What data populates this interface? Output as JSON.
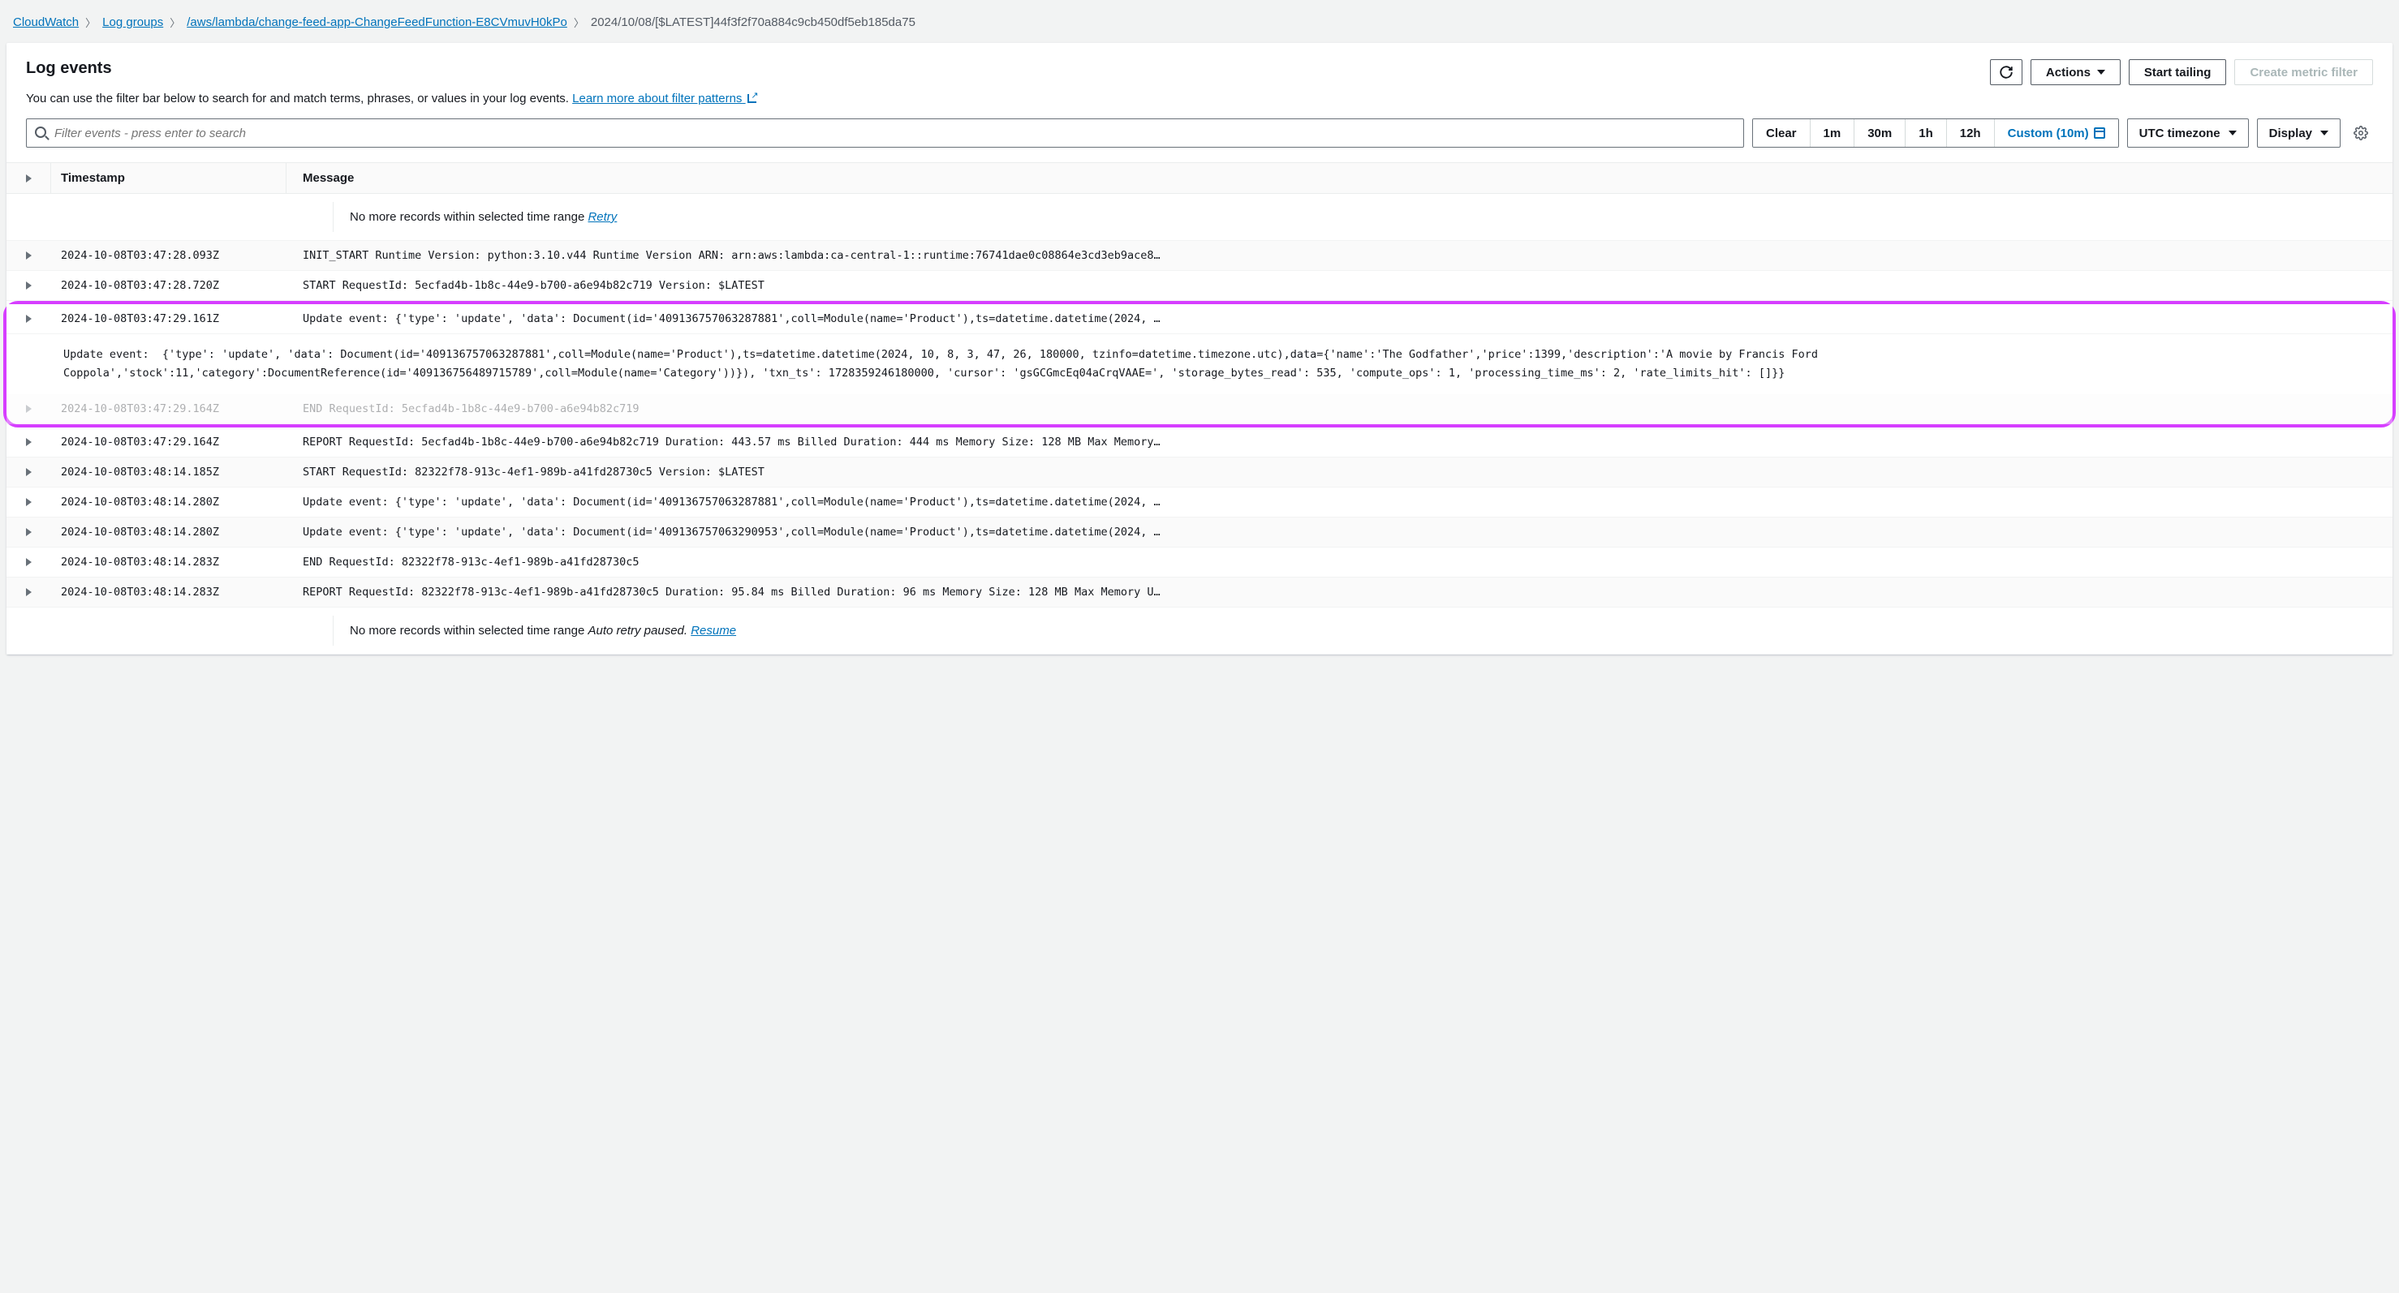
{
  "breadcrumb": {
    "items": [
      {
        "label": "CloudWatch",
        "link": true
      },
      {
        "label": "Log groups",
        "link": true
      },
      {
        "label": "/aws/lambda/change-feed-app-ChangeFeedFunction-E8CVmuvH0kPo",
        "link": true
      },
      {
        "label": "2024/10/08/[$LATEST]44f3f2f70a884c9cb450df5eb185da75",
        "link": false
      }
    ]
  },
  "header": {
    "title": "Log events",
    "subtext": "You can use the filter bar below to search for and match terms, phrases, or values in your log events. ",
    "learn_link": "Learn more about filter patterns",
    "actions_label": "Actions",
    "start_tailing_label": "Start tailing",
    "create_filter_label": "Create metric filter"
  },
  "controls": {
    "search_placeholder": "Filter events - press enter to search",
    "clear_label": "Clear",
    "ranges": [
      "1m",
      "30m",
      "1h",
      "12h"
    ],
    "custom_label": "Custom (10m)",
    "timezone_label": "UTC timezone",
    "display_label": "Display"
  },
  "table": {
    "col_timestamp": "Timestamp",
    "col_message": "Message",
    "top_info": "No more records within selected time range ",
    "retry_label": "Retry",
    "bottom_info_a": "No more records within selected time range ",
    "bottom_info_b": "Auto retry paused. ",
    "resume_label": "Resume"
  },
  "rows": [
    {
      "ts": "2024-10-08T03:47:28.093Z",
      "msg": "INIT_START Runtime Version: python:3.10.v44 Runtime Version ARN: arn:aws:lambda:ca-central-1::runtime:76741dae0c08864e3cd3eb9ace8…"
    },
    {
      "ts": "2024-10-08T03:47:28.720Z",
      "msg": "START RequestId: 5ecfad4b-1b8c-44e9-b700-a6e94b82c719 Version: $LATEST"
    },
    {
      "ts": "2024-10-08T03:47:29.161Z",
      "msg": "Update event: {'type': 'update', 'data': Document(id='409136757063287881',coll=Module(name='Product'),ts=datetime.datetime(2024, …",
      "expanded": true
    },
    {
      "ts": "2024-10-08T03:47:29.164Z",
      "msg": "END RequestId: 5ecfad4b-1b8c-44e9-b700-a6e94b82c719"
    },
    {
      "ts": "2024-10-08T03:47:29.164Z",
      "msg": "REPORT RequestId: 5ecfad4b-1b8c-44e9-b700-a6e94b82c719 Duration: 443.57 ms Billed Duration: 444 ms Memory Size: 128 MB Max Memory…"
    },
    {
      "ts": "2024-10-08T03:48:14.185Z",
      "msg": "START RequestId: 82322f78-913c-4ef1-989b-a41fd28730c5 Version: $LATEST"
    },
    {
      "ts": "2024-10-08T03:48:14.280Z",
      "msg": "Update event: {'type': 'update', 'data': Document(id='409136757063287881',coll=Module(name='Product'),ts=datetime.datetime(2024, …"
    },
    {
      "ts": "2024-10-08T03:48:14.280Z",
      "msg": "Update event: {'type': 'update', 'data': Document(id='409136757063290953',coll=Module(name='Product'),ts=datetime.datetime(2024, …"
    },
    {
      "ts": "2024-10-08T03:48:14.283Z",
      "msg": "END RequestId: 82322f78-913c-4ef1-989b-a41fd28730c5"
    },
    {
      "ts": "2024-10-08T03:48:14.283Z",
      "msg": "REPORT RequestId: 82322f78-913c-4ef1-989b-a41fd28730c5 Duration: 95.84 ms Billed Duration: 96 ms Memory Size: 128 MB Max Memory U…"
    }
  ],
  "expanded_detail": "Update event:  {'type': 'update', 'data': Document(id='409136757063287881',coll=Module(name='Product'),ts=datetime.datetime(2024, 10, 8, 3, 47, 26, 180000, tzinfo=datetime.timezone.utc),data={'name':'The Godfather','price':1399,'description':'A movie by Francis Ford Coppola','stock':11,'category':DocumentReference(id='409136756489715789',coll=Module(name='Category'))}), 'txn_ts': 1728359246180000, 'cursor': 'gsGCGmcEq04aCrqVAAE=', 'storage_bytes_read': 535, 'compute_ops': 1, 'processing_time_ms': 2, 'rate_limits_hit': []}}"
}
